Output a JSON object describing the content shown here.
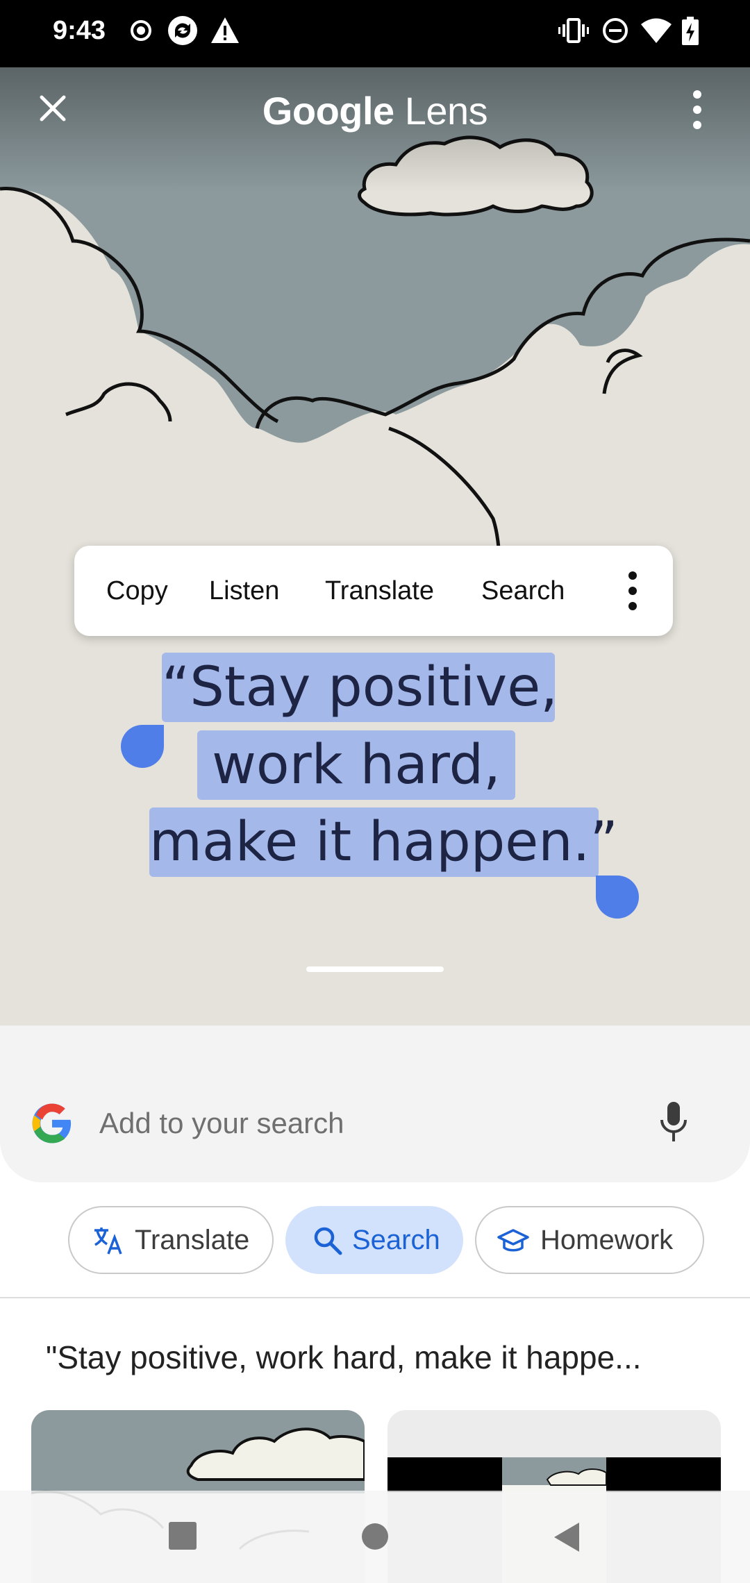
{
  "status_bar": {
    "time": "9:43",
    "left_icons": [
      "record-icon",
      "sync-icon",
      "warning-icon"
    ],
    "right_icons": [
      "vibrate-icon",
      "do-not-disturb-icon",
      "wifi-icon",
      "battery-charging-icon"
    ]
  },
  "header": {
    "title_brand": "Google",
    "title_product": "Lens",
    "close_icon": "close-icon",
    "menu_icon": "more-vertical-icon"
  },
  "text_actions": {
    "items": [
      "Copy",
      "Listen",
      "Translate",
      "Search"
    ],
    "more_icon": "more-vertical-icon"
  },
  "selection": {
    "lines": [
      "“Stay positive,",
      "work hard,",
      "make it happen.”"
    ]
  },
  "search_panel": {
    "placeholder": "Add to your search",
    "logo_icon": "google-g-icon",
    "mic_icon": "mic-icon",
    "chips": [
      {
        "label": "Translate",
        "icon": "translate-icon",
        "active": false
      },
      {
        "label": "Search",
        "icon": "search-icon",
        "active": true
      },
      {
        "label": "Homework",
        "icon": "graduation-cap-icon",
        "active": false
      }
    ],
    "result_title": "\"Stay positive, work hard, make it happe..."
  },
  "nav_bar": {
    "buttons": [
      "recents-square-icon",
      "home-circle-icon",
      "back-triangle-icon"
    ]
  },
  "colors": {
    "sky": "#8c9a9d",
    "cloud": "#e4e2da",
    "selection_handle": "#4f7ee9",
    "selection_fill": "#8ca8f0",
    "active_chip_bg": "#d3e2fc",
    "active_chip_text": "#1a62d6"
  }
}
